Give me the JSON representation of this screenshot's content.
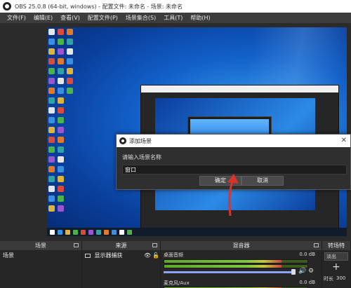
{
  "window": {
    "title": "OBS 25.0.8 (64-bit, windows) - 配置文件: 未命名 - 场景: 未命名"
  },
  "menu": [
    "文件(F)",
    "编辑(E)",
    "查看(V)",
    "配置文件(P)",
    "场景集合(S)",
    "工具(T)",
    "帮助(H)"
  ],
  "dialog": {
    "title": "添加场景",
    "prompt": "请输入场景名称",
    "value": "窗口",
    "ok_label": "确定",
    "cancel_label": "取消",
    "close_glyph": "✕"
  },
  "panels": {
    "scenes": {
      "header": "场景",
      "items": [
        "场景"
      ]
    },
    "sources": {
      "header": "来源",
      "items": [
        "显示器捕获"
      ]
    },
    "mixer": {
      "header": "混音器",
      "channels": [
        {
          "name": "桌面音频",
          "level_db": "0.0 dB",
          "meter_fraction": 0.82,
          "volume_fraction": 1.0
        },
        {
          "name": "麦克风/Aux",
          "level_db": "0.0 dB",
          "meter_fraction": 0.82,
          "volume_fraction": 1.0
        }
      ]
    },
    "transitions": {
      "header": "转场特",
      "fade": "淡出",
      "add": "+",
      "duration_label": "时长",
      "duration_value": "300"
    }
  },
  "icons": {
    "app": "obs-logo-icon",
    "eye": "eye-icon",
    "lock": "lock-icon",
    "speaker": "speaker-icon",
    "gear": "gear-icon"
  },
  "colors": {
    "accent": "#2a87e0",
    "arrow": "#d9342b",
    "panel_bg": "#2b2b2b"
  }
}
